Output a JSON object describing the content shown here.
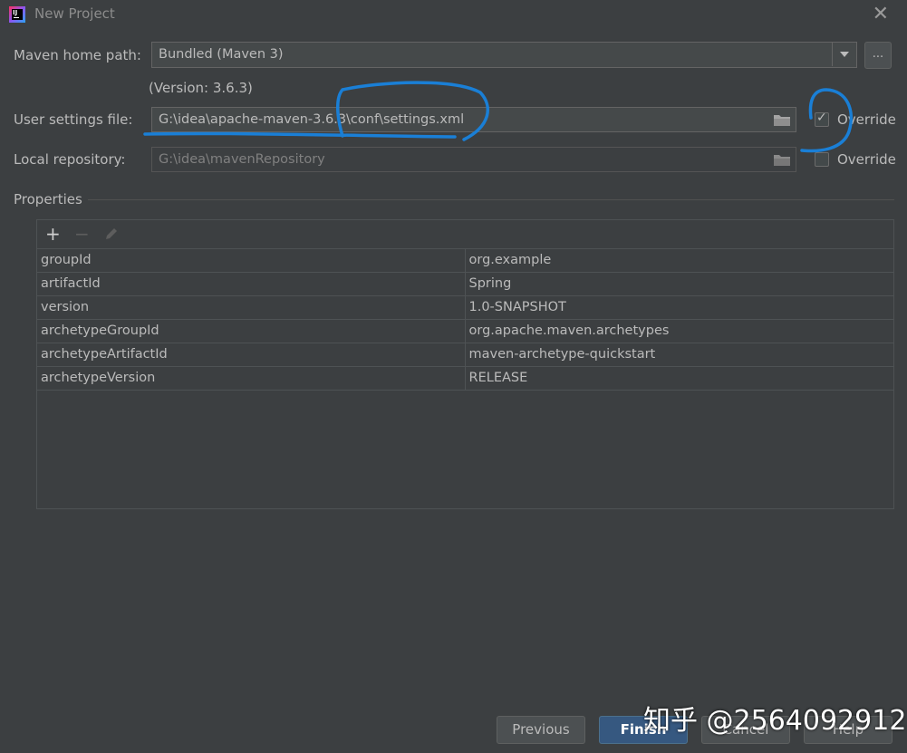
{
  "window": {
    "title": "New Project",
    "icon": "intellij-idea-icon"
  },
  "maven_home": {
    "label": "Maven home path:",
    "value": "Bundled (Maven 3)",
    "browse_label": "...",
    "version": "(Version: 3.6.3)"
  },
  "user_settings": {
    "label": "User settings file:",
    "value": "G:\\idea\\apache-maven-3.6.3\\conf\\settings.xml",
    "override_label": "Override",
    "override_checked": true
  },
  "local_repo": {
    "label": "Local repository:",
    "value": "G:\\idea\\mavenRepository",
    "override_label": "Override",
    "override_checked": false
  },
  "properties": {
    "title": "Properties",
    "toolbar": {
      "add": "+",
      "remove": "−"
    },
    "rows": [
      {
        "key": "groupId",
        "value": "org.example"
      },
      {
        "key": "artifactId",
        "value": "Spring"
      },
      {
        "key": "version",
        "value": "1.0-SNAPSHOT"
      },
      {
        "key": "archetypeGroupId",
        "value": "org.apache.maven.archetypes"
      },
      {
        "key": "archetypeArtifactId",
        "value": "maven-archetype-quickstart"
      },
      {
        "key": "archetypeVersion",
        "value": "RELEASE"
      }
    ]
  },
  "buttons": {
    "previous": "Previous",
    "finish": "Finish",
    "cancel": "Cancel",
    "help": "Help"
  },
  "watermark": "知乎 @2564092912",
  "colors": {
    "annotation": "#1a7fd6",
    "primary_button": "#365880",
    "background": "#3c3f41"
  }
}
